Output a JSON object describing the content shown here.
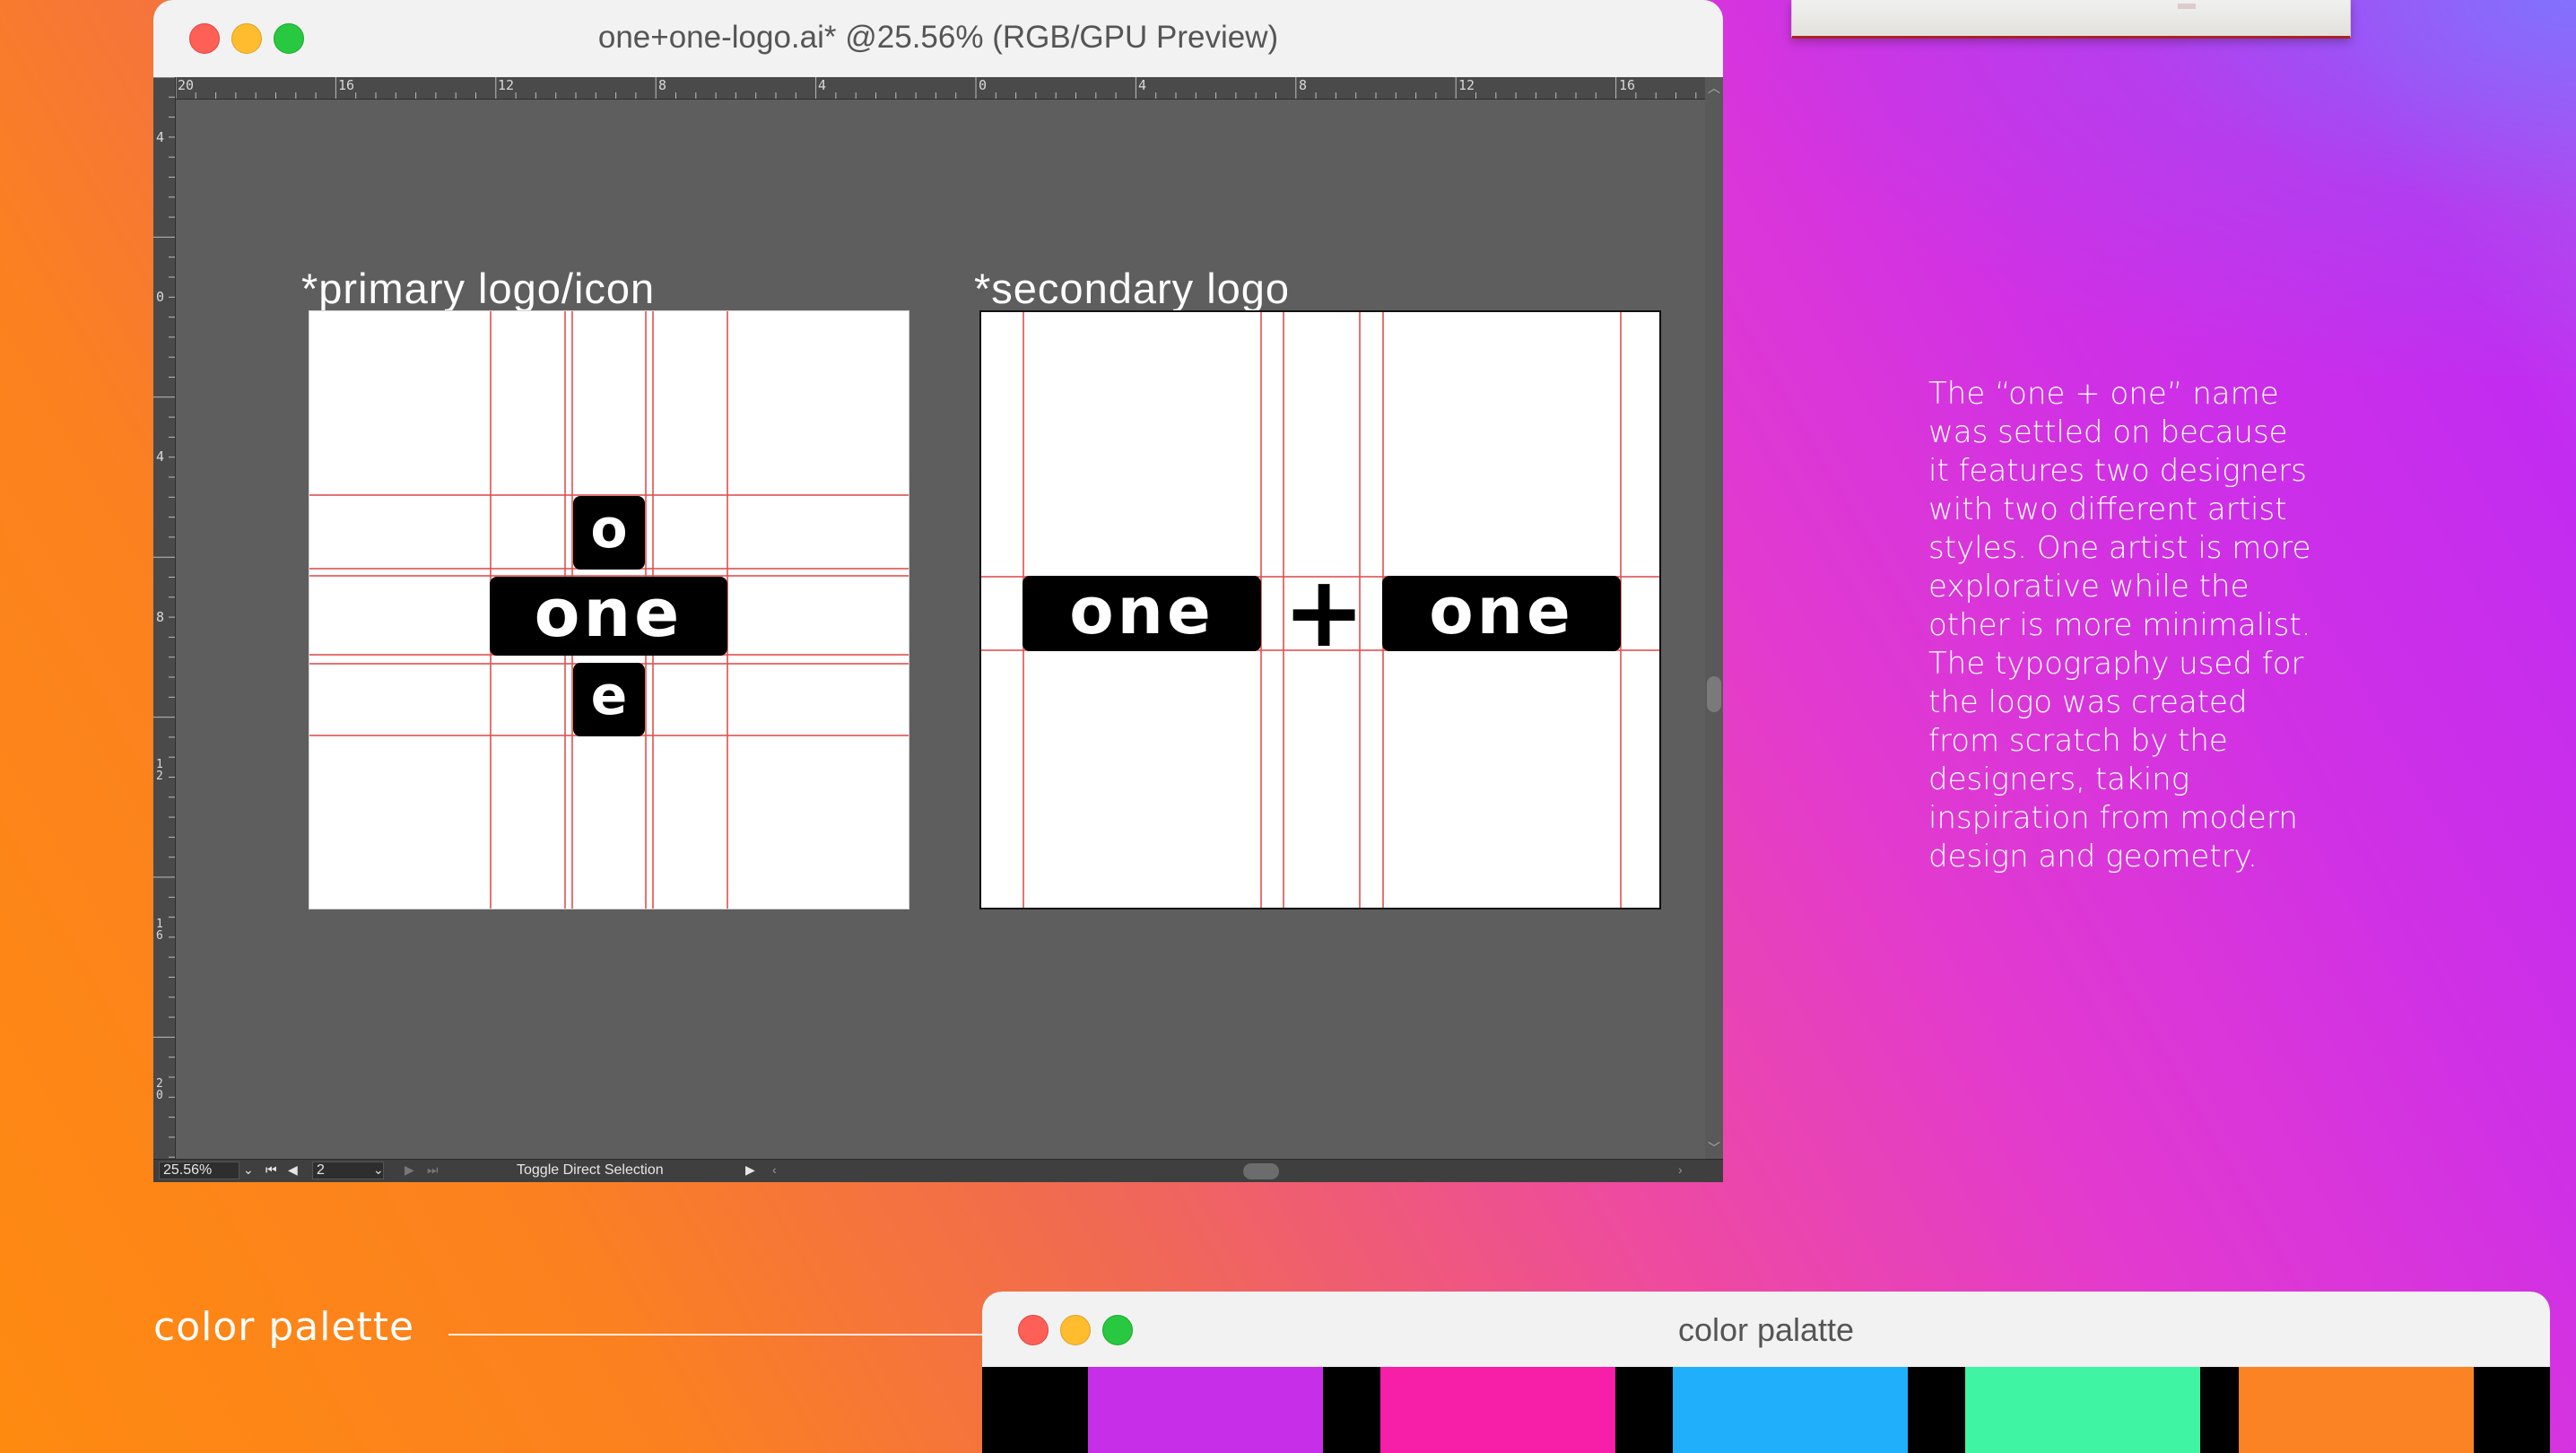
{
  "window": {
    "title": "one+one-logo.ai* @25.56% (RGB/GPU Preview)"
  },
  "ruler": {
    "horizontal": [
      "20",
      "16",
      "12",
      "8",
      "4",
      "0",
      "4",
      "8",
      "12",
      "16"
    ],
    "vertical": [
      "4",
      "0",
      "4",
      "8",
      "1\n2",
      "1\n6",
      "2\n0"
    ]
  },
  "artboards": {
    "primary_label": "*primary logo/icon",
    "secondary_label": "*secondary logo",
    "primary_logo": {
      "top": "o",
      "middle": "one",
      "bottom": "e"
    },
    "secondary_logo": {
      "left": "one",
      "plus": "+",
      "right": "one"
    }
  },
  "statusbar": {
    "zoom": "25.56%",
    "artboard_number": "2",
    "tool": "Toggle Direct Selection"
  },
  "description": "The “one + one” name\nwas settled on because\nit features two designers\nwith two different artist\nstyles. One artist is more\nexplorative while the\nother is more minimalist.\nThe typography used for\nthe logo was created\nfrom scratch by the\ndesigners, taking\ninspiration from modern\ndesign and geometry.",
  "palette": {
    "heading": "color palette",
    "window_title": "color palatte",
    "colors": [
      "#c62ee8",
      "#f71ea8",
      "#20b0fb",
      "#3ff5a4",
      "#fb8323"
    ]
  },
  "icons": {
    "close": "close-icon",
    "minimize": "minimize-icon",
    "zoom": "zoom-icon",
    "dropdown": "chevron-down-icon",
    "first": "first-page-icon",
    "prev": "previous-icon",
    "next": "next-icon",
    "last": "last-page-icon"
  }
}
